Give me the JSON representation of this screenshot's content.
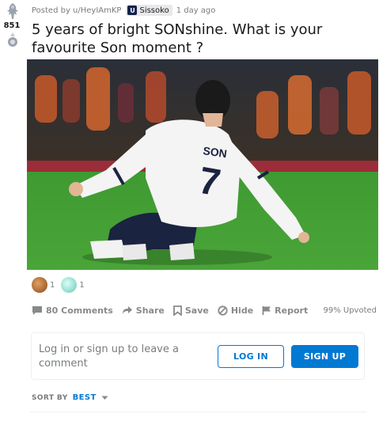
{
  "post": {
    "score": "851",
    "posted_by": "Posted by u/HeyIAmKP",
    "flair_icon": "U",
    "flair_text": "Sissoko",
    "time": "1 day ago",
    "title": "5 years of bright SONshine. What is your favourite Son moment ?"
  },
  "photo": {
    "shirt_name": "SON",
    "shirt_number": "7"
  },
  "awards": [
    {
      "icon": "award-bear-icon",
      "count": "1",
      "color": "#b86a2f"
    },
    {
      "icon": "award-angel-icon",
      "count": "1",
      "color": "#7fd1c7"
    }
  ],
  "actions": {
    "comments": "80 Comments",
    "share": "Share",
    "save": "Save",
    "hide": "Hide",
    "report": "Report",
    "upvoted": "99% Upvoted"
  },
  "login": {
    "prompt": "Log in or sign up to leave a comment",
    "login_label": "LOG IN",
    "signup_label": "SIGN UP"
  },
  "sort": {
    "label": "SORT BY",
    "value": "BEST"
  },
  "colors": {
    "accent": "#0079d3",
    "muted": "#878a8c",
    "text": "#1a1a1b"
  }
}
